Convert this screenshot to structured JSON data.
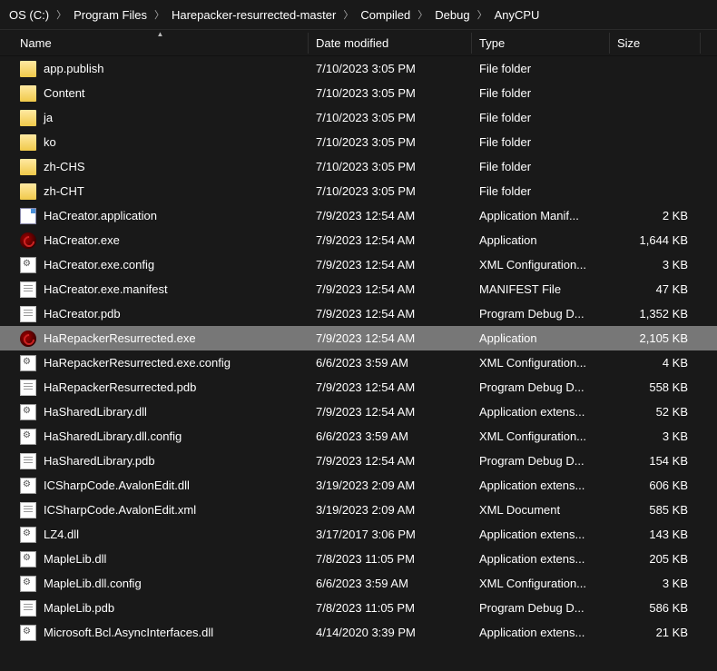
{
  "breadcrumb": [
    "OS (C:)",
    "Program Files",
    "Harepacker-resurrected-master",
    "Compiled",
    "Debug",
    "AnyCPU"
  ],
  "columns": {
    "name": "Name",
    "date": "Date modified",
    "type": "Type",
    "size": "Size"
  },
  "files": [
    {
      "icon": "folder",
      "name": "app.publish",
      "date": "7/10/2023 3:05 PM",
      "type": "File folder",
      "size": "",
      "selected": false
    },
    {
      "icon": "folder",
      "name": "Content",
      "date": "7/10/2023 3:05 PM",
      "type": "File folder",
      "size": "",
      "selected": false
    },
    {
      "icon": "folder",
      "name": "ja",
      "date": "7/10/2023 3:05 PM",
      "type": "File folder",
      "size": "",
      "selected": false
    },
    {
      "icon": "folder",
      "name": "ko",
      "date": "7/10/2023 3:05 PM",
      "type": "File folder",
      "size": "",
      "selected": false
    },
    {
      "icon": "folder",
      "name": "zh-CHS",
      "date": "7/10/2023 3:05 PM",
      "type": "File folder",
      "size": "",
      "selected": false
    },
    {
      "icon": "folder",
      "name": "zh-CHT",
      "date": "7/10/2023 3:05 PM",
      "type": "File folder",
      "size": "",
      "selected": false
    },
    {
      "icon": "manifest",
      "name": "HaCreator.application",
      "date": "7/9/2023 12:54 AM",
      "type": "Application Manif...",
      "size": "2 KB",
      "selected": false
    },
    {
      "icon": "exe-red",
      "name": "HaCreator.exe",
      "date": "7/9/2023 12:54 AM",
      "type": "Application",
      "size": "1,644 KB",
      "selected": false
    },
    {
      "icon": "config",
      "name": "HaCreator.exe.config",
      "date": "7/9/2023 12:54 AM",
      "type": "XML Configuration...",
      "size": "3 KB",
      "selected": false
    },
    {
      "icon": "file",
      "name": "HaCreator.exe.manifest",
      "date": "7/9/2023 12:54 AM",
      "type": "MANIFEST File",
      "size": "47 KB",
      "selected": false
    },
    {
      "icon": "file",
      "name": "HaCreator.pdb",
      "date": "7/9/2023 12:54 AM",
      "type": "Program Debug D...",
      "size": "1,352 KB",
      "selected": false
    },
    {
      "icon": "exe-red",
      "name": "HaRepackerResurrected.exe",
      "date": "7/9/2023 12:54 AM",
      "type": "Application",
      "size": "2,105 KB",
      "selected": true
    },
    {
      "icon": "config",
      "name": "HaRepackerResurrected.exe.config",
      "date": "6/6/2023 3:59 AM",
      "type": "XML Configuration...",
      "size": "4 KB",
      "selected": false
    },
    {
      "icon": "file",
      "name": "HaRepackerResurrected.pdb",
      "date": "7/9/2023 12:54 AM",
      "type": "Program Debug D...",
      "size": "558 KB",
      "selected": false
    },
    {
      "icon": "config",
      "name": "HaSharedLibrary.dll",
      "date": "7/9/2023 12:54 AM",
      "type": "Application extens...",
      "size": "52 KB",
      "selected": false
    },
    {
      "icon": "config",
      "name": "HaSharedLibrary.dll.config",
      "date": "6/6/2023 3:59 AM",
      "type": "XML Configuration...",
      "size": "3 KB",
      "selected": false
    },
    {
      "icon": "file",
      "name": "HaSharedLibrary.pdb",
      "date": "7/9/2023 12:54 AM",
      "type": "Program Debug D...",
      "size": "154 KB",
      "selected": false
    },
    {
      "icon": "config",
      "name": "ICSharpCode.AvalonEdit.dll",
      "date": "3/19/2023 2:09 AM",
      "type": "Application extens...",
      "size": "606 KB",
      "selected": false
    },
    {
      "icon": "file",
      "name": "ICSharpCode.AvalonEdit.xml",
      "date": "3/19/2023 2:09 AM",
      "type": "XML Document",
      "size": "585 KB",
      "selected": false
    },
    {
      "icon": "config",
      "name": "LZ4.dll",
      "date": "3/17/2017 3:06 PM",
      "type": "Application extens...",
      "size": "143 KB",
      "selected": false
    },
    {
      "icon": "config",
      "name": "MapleLib.dll",
      "date": "7/8/2023 11:05 PM",
      "type": "Application extens...",
      "size": "205 KB",
      "selected": false
    },
    {
      "icon": "config",
      "name": "MapleLib.dll.config",
      "date": "6/6/2023 3:59 AM",
      "type": "XML Configuration...",
      "size": "3 KB",
      "selected": false
    },
    {
      "icon": "file",
      "name": "MapleLib.pdb",
      "date": "7/8/2023 11:05 PM",
      "type": "Program Debug D...",
      "size": "586 KB",
      "selected": false
    },
    {
      "icon": "config",
      "name": "Microsoft.Bcl.AsyncInterfaces.dll",
      "date": "4/14/2020 3:39 PM",
      "type": "Application extens...",
      "size": "21 KB",
      "selected": false
    }
  ]
}
